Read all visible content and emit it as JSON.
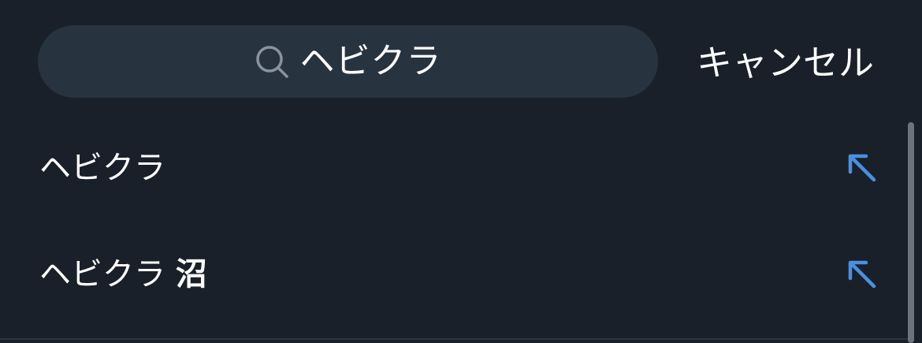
{
  "search": {
    "value": "ヘビクラ",
    "icon": "search-icon"
  },
  "header": {
    "cancel_label": "キャンセル"
  },
  "suggestions": [
    {
      "prefix": "ヘビクラ",
      "suffix": "",
      "icon": "arrow-up-left-icon"
    },
    {
      "prefix": "ヘビクラ ",
      "suffix": "沼",
      "icon": "arrow-up-left-icon"
    }
  ],
  "colors": {
    "background": "#19202a",
    "search_bg": "#283340",
    "accent": "#4a90e2",
    "text": "#ffffff",
    "icon_muted": "#8a939c"
  }
}
